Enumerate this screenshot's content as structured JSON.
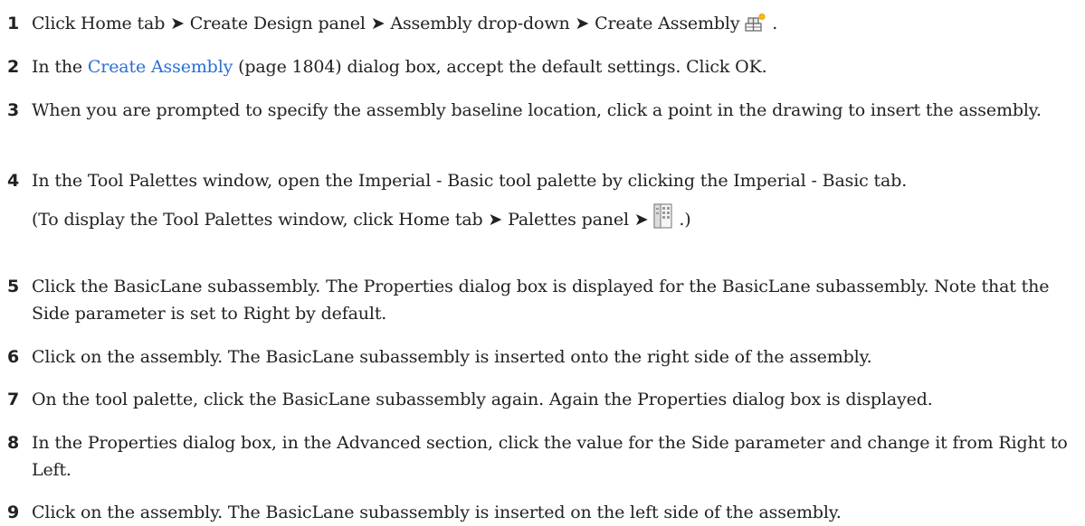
{
  "steps": [
    {
      "number": "1",
      "before": "Click Home tab ➤ Create Design panel ➤ Assembly drop-down ➤ Create Assembly",
      "after": "."
    },
    {
      "number": "2",
      "before": "In the",
      "link": "Create Assembly",
      "after": "(page 1804) dialog box, accept the default settings. Click OK."
    },
    {
      "number": "3",
      "text": "When you are prompted to specify the assembly baseline location, click a point in the drawing to insert the assembly."
    },
    {
      "number": "4",
      "text": "In the Tool Palettes window, open the Imperial - Basic tool palette by clicking the Imperial - Basic tab.",
      "note_before": "(To display the Tool Palettes window, click Home tab ➤ Palettes panel ➤",
      "note_after": ".)"
    },
    {
      "number": "5",
      "text": "Click the BasicLane subassembly. The Properties dialog box is displayed for the BasicLane subassembly. Note that the Side parameter is set to Right by default."
    },
    {
      "number": "6",
      "text": "Click on the assembly. The BasicLane subassembly is inserted onto the right side of the assembly."
    },
    {
      "number": "7",
      "text": "On the tool palette, click the BasicLane subassembly again. Again the Properties dialog box is displayed."
    },
    {
      "number": "8",
      "text": "In the Properties dialog box, in the Advanced section, click the value for the Side parameter and change it from Right to Left."
    },
    {
      "number": "9",
      "text": "Click on the assembly. The BasicLane subassembly is inserted on the left side of the assembly."
    }
  ],
  "icons": {
    "create_assembly": "create-assembly-icon",
    "tool_palettes": "tool-palettes-icon"
  },
  "colors": {
    "link": "#2a6fd6",
    "text": "#222222"
  }
}
